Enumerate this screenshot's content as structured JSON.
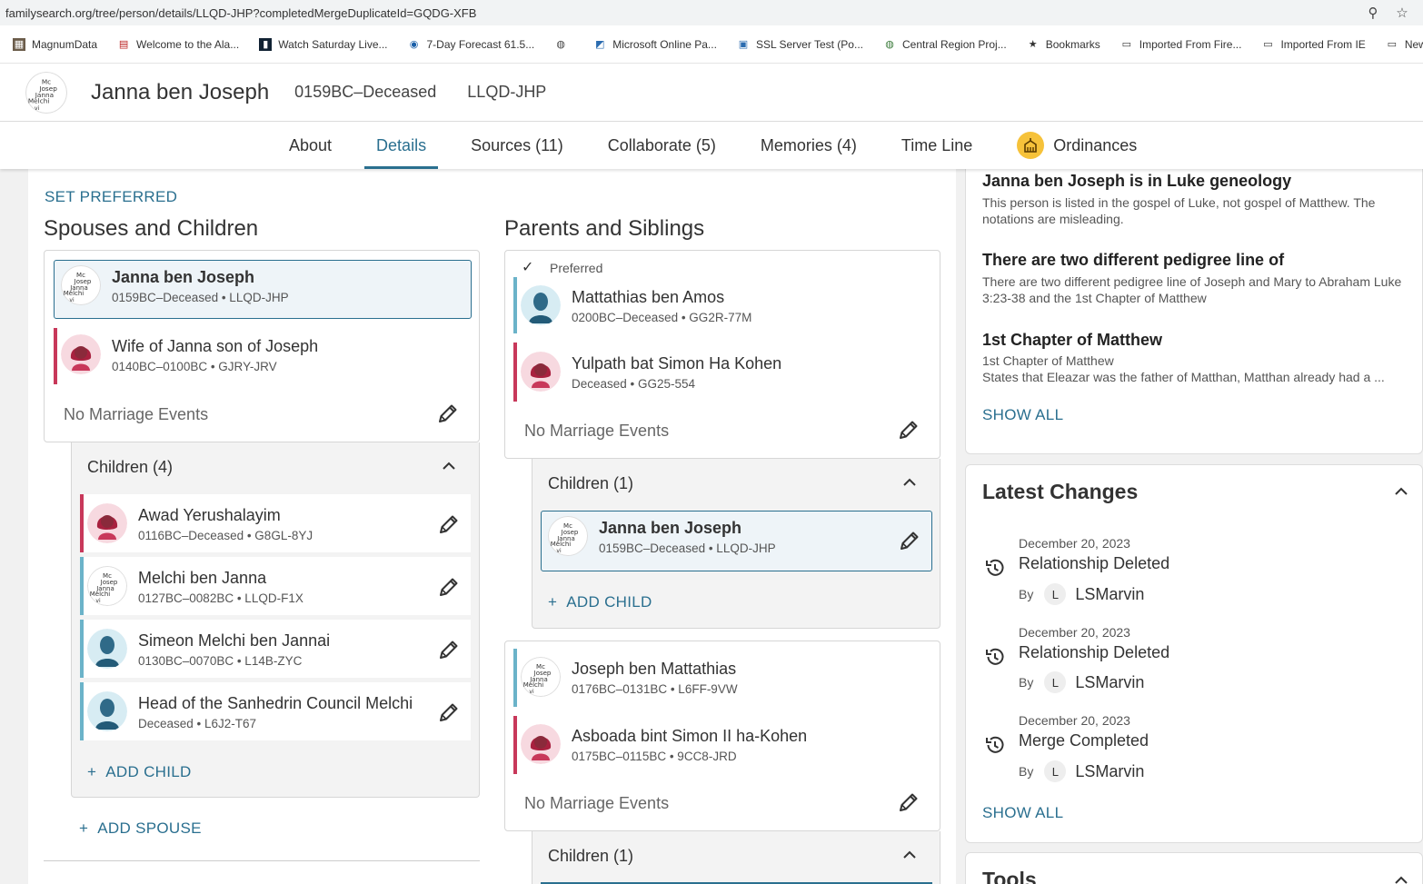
{
  "browser": {
    "url": "familysearch.org/tree/person/details/LLQD-JHP?completedMergeDuplicateId=GQDG-XFB",
    "bookmarks": [
      {
        "label": "MagnumData",
        "icon": "chart-icon"
      },
      {
        "label": "Welcome to the Ala...",
        "icon": "flag-icon"
      },
      {
        "label": "Watch Saturday Live...",
        "icon": "tv-icon"
      },
      {
        "label": "7-Day Forecast 61.5...",
        "icon": "weather-icon"
      },
      {
        "label": "",
        "icon": "globe-icon"
      },
      {
        "label": "Microsoft Online Pa...",
        "icon": "ms-icon"
      },
      {
        "label": "SSL Server Test (Po...",
        "icon": "lock-icon"
      },
      {
        "label": "Central Region Proj...",
        "icon": "globe-icon"
      },
      {
        "label": "Bookmarks",
        "icon": "star-icon"
      },
      {
        "label": "Imported From Fire...",
        "icon": "folder-icon"
      },
      {
        "label": "Imported From IE",
        "icon": "folder-icon"
      },
      {
        "label": "NewHom",
        "icon": "folder-icon"
      }
    ]
  },
  "person": {
    "name": "Janna ben Joseph",
    "lifespan": "0159BC–Deceased",
    "pid": "LLQD-JHP"
  },
  "tabs": [
    {
      "label": "About"
    },
    {
      "label": "Details"
    },
    {
      "label": "Sources (11)"
    },
    {
      "label": "Collaborate (5)"
    },
    {
      "label": "Memories (4)"
    },
    {
      "label": "Time Line"
    },
    {
      "label": "Ordinances"
    }
  ],
  "main": {
    "set_preferred": "SET PREFERRED",
    "spouses_title": "Spouses and Children",
    "parents_title": "Parents and Siblings",
    "spouse_family": {
      "husband": {
        "name": "Janna ben Joseph",
        "sub": "0159BC–Deceased • LLQD-JHP"
      },
      "wife": {
        "name": "Wife of Janna son of Joseph",
        "sub": "0140BC–0100BC • GJRY-JRV"
      },
      "no_marriage": "No Marriage Events",
      "children_header": "Children (4)",
      "children": [
        {
          "name": "Awad Yerushalayim",
          "sub": "0116BC–Deceased • G8GL-8YJ",
          "gender": "female"
        },
        {
          "name": "Melchi ben Janna",
          "sub": "0127BC–0082BC • LLQD-F1X",
          "gender": "male"
        },
        {
          "name": "Simeon Melchi ben Jannai",
          "sub": "0130BC–0070BC • L14B-ZYC",
          "gender": "male"
        },
        {
          "name": "Head of the Sanhedrin Council Melchi",
          "sub": "Deceased • L6J2-T67",
          "gender": "male"
        }
      ],
      "add_child": "ADD CHILD",
      "add_spouse": "ADD SPOUSE"
    },
    "parent_family_1": {
      "preferred": "Preferred",
      "father": {
        "name": "Mattathias ben Amos",
        "sub": "0200BC–Deceased • GG2R-77M"
      },
      "mother": {
        "name": "Yulpath bat Simon Ha Kohen",
        "sub": "Deceased • GG25-554"
      },
      "no_marriage": "No Marriage Events",
      "children_header": "Children (1)",
      "child": {
        "name": "Janna ben Joseph",
        "sub": "0159BC–Deceased • LLQD-JHP"
      },
      "add_child": "ADD CHILD"
    },
    "parent_family_2": {
      "father": {
        "name": "Joseph ben Mattathias",
        "sub": "0176BC–0131BC • L6FF-9VW"
      },
      "mother": {
        "name": "Asboada bint Simon II ha-Kohen",
        "sub": "0175BC–0115BC • 9CC8-JRD"
      },
      "no_marriage": "No Marriage Events",
      "children_header": "Children (1)"
    }
  },
  "sidebar": {
    "notes": [
      {
        "title": "Janna ben Joseph is in Luke geneology",
        "text": "This person is listed in the gospel of Luke, not gospel of Matthew. The notations are misleading."
      },
      {
        "title": "There are two different pedigree line of",
        "text": "There are two different pedigree line of Joseph and Mary to Abraham Luke 3:23-38 and the 1st Chapter of Matthew"
      },
      {
        "title": "1st Chapter of Matthew",
        "text": "1st Chapter of Matthew",
        "text2": "States that Eleazar was the father of Matthan, Matthan already had a ..."
      }
    ],
    "notes_show_all": "SHOW ALL",
    "latest_changes": {
      "title": "Latest Changes",
      "items": [
        {
          "date": "December 20, 2023",
          "type": "Relationship Deleted",
          "by": "By",
          "badge": "L",
          "user": "LSMarvin"
        },
        {
          "date": "December 20, 2023",
          "type": "Relationship Deleted",
          "by": "By",
          "badge": "L",
          "user": "LSMarvin"
        },
        {
          "date": "December 20, 2023",
          "type": "Merge Completed",
          "by": "By",
          "badge": "L",
          "user": "LSMarvin"
        }
      ],
      "show_all": "SHOW ALL"
    },
    "tools_title": "Tools"
  },
  "colors": {
    "accent": "#2a6f8f",
    "female": "#c8385a",
    "male": "#6bb3c9",
    "ordinance": "#f6c23a"
  }
}
